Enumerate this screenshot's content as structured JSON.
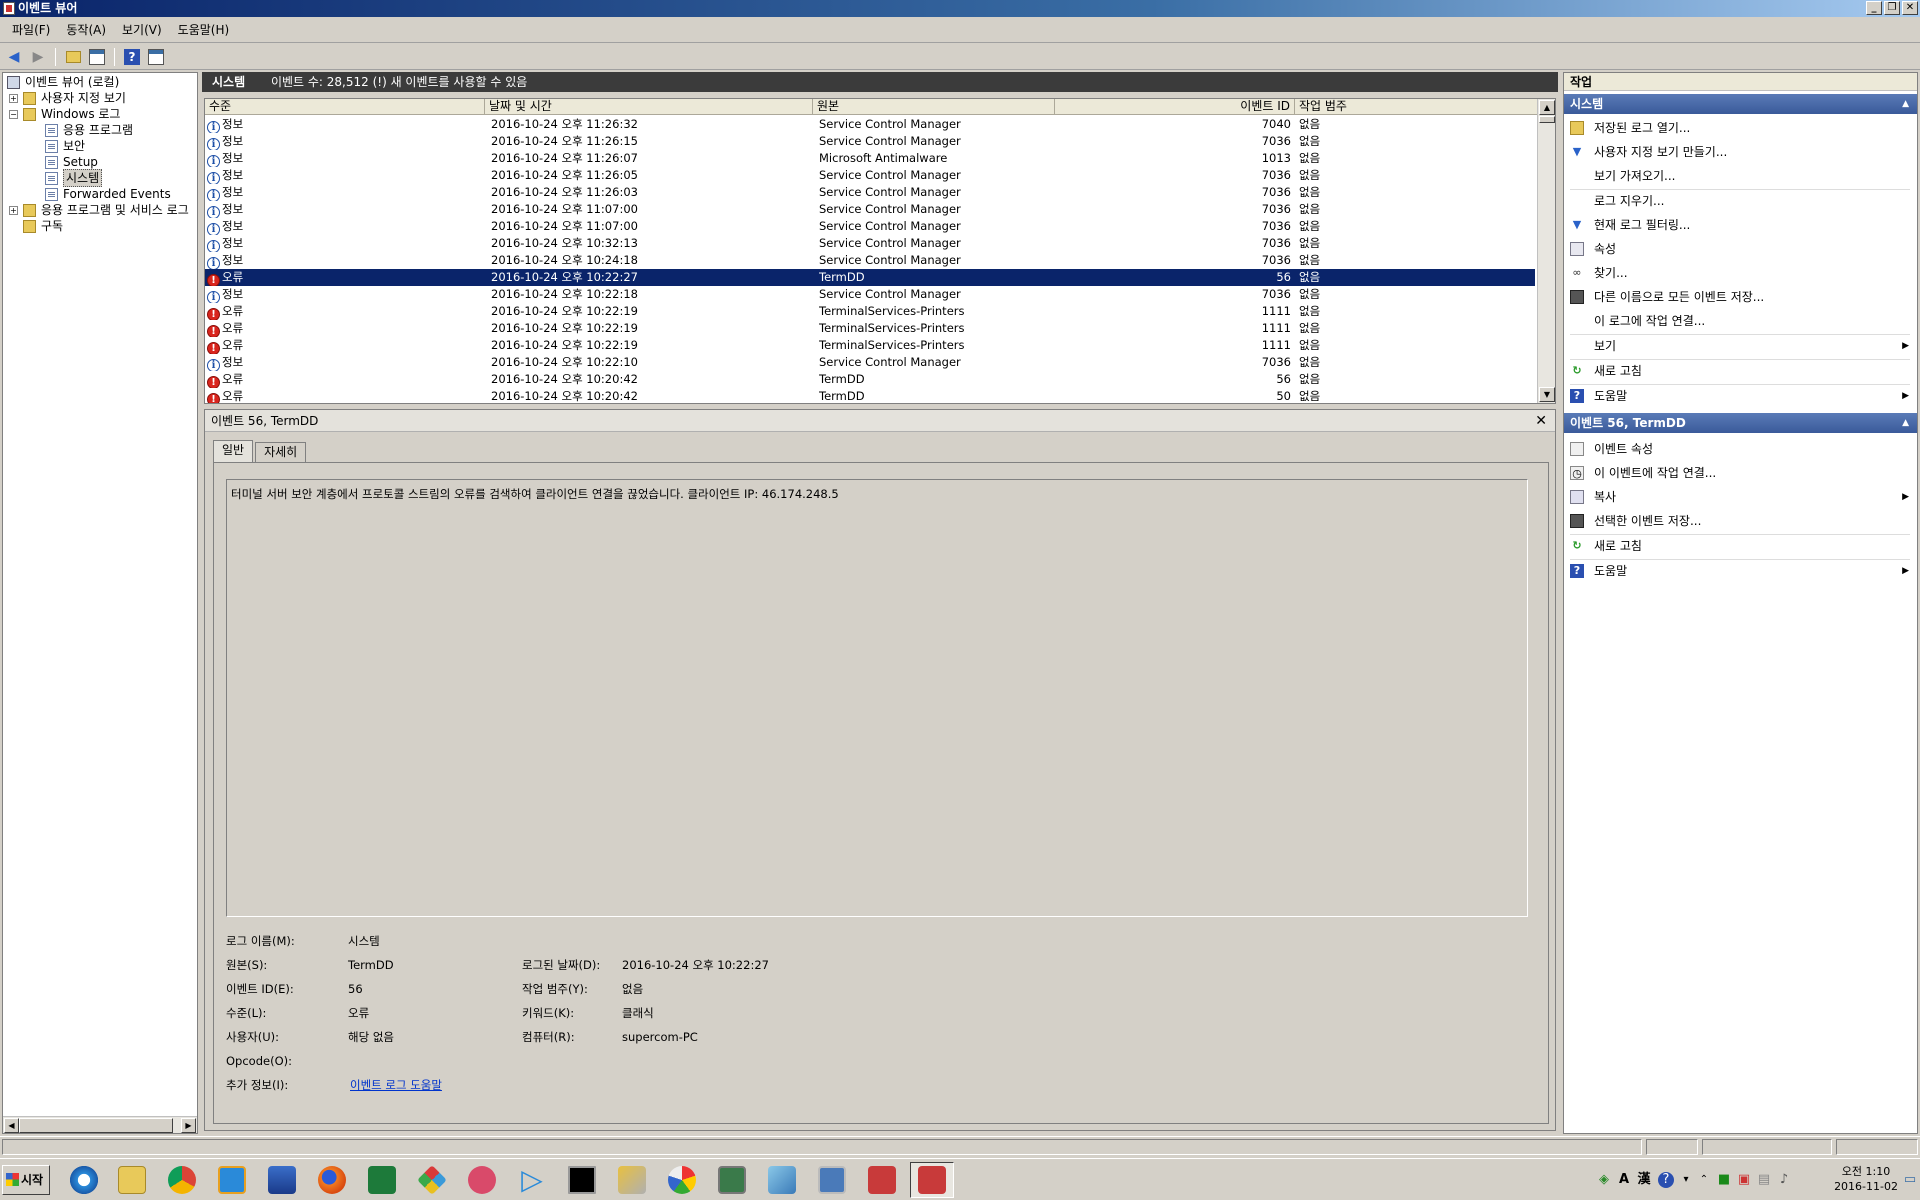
{
  "window": {
    "title": "이벤트 뷰어"
  },
  "menu": [
    "파일(F)",
    "동작(A)",
    "보기(V)",
    "도움말(H)"
  ],
  "tree": {
    "root": "이벤트 뷰어 (로컬)",
    "custom_views": "사용자 지정 보기",
    "windows_logs": "Windows 로그",
    "logs": [
      "응용 프로그램",
      "보안",
      "Setup",
      "시스템",
      "Forwarded Events"
    ],
    "app_services": "응용 프로그램 및 서비스 로그",
    "subscriptions": "구독"
  },
  "center_header": {
    "title": "시스템",
    "info": "이벤트 수: 28,512 (!) 새 이벤트를 사용할 수 있음"
  },
  "columns": [
    "수준",
    "날짜 및 시간",
    "원본",
    "이벤트 ID",
    "작업 범주"
  ],
  "events": [
    {
      "level": "정보",
      "type": "info",
      "datetime": "2016-10-24 오후 11:26:32",
      "source": "Service Control Manager",
      "id": "7040",
      "category": "없음"
    },
    {
      "level": "정보",
      "type": "info",
      "datetime": "2016-10-24 오후 11:26:15",
      "source": "Service Control Manager",
      "id": "7036",
      "category": "없음"
    },
    {
      "level": "정보",
      "type": "info",
      "datetime": "2016-10-24 오후 11:26:07",
      "source": "Microsoft Antimalware",
      "id": "1013",
      "category": "없음"
    },
    {
      "level": "정보",
      "type": "info",
      "datetime": "2016-10-24 오후 11:26:05",
      "source": "Service Control Manager",
      "id": "7036",
      "category": "없음"
    },
    {
      "level": "정보",
      "type": "info",
      "datetime": "2016-10-24 오후 11:26:03",
      "source": "Service Control Manager",
      "id": "7036",
      "category": "없음"
    },
    {
      "level": "정보",
      "type": "info",
      "datetime": "2016-10-24 오후 11:07:00",
      "source": "Service Control Manager",
      "id": "7036",
      "category": "없음"
    },
    {
      "level": "정보",
      "type": "info",
      "datetime": "2016-10-24 오후 11:07:00",
      "source": "Service Control Manager",
      "id": "7036",
      "category": "없음"
    },
    {
      "level": "정보",
      "type": "info",
      "datetime": "2016-10-24 오후 10:32:13",
      "source": "Service Control Manager",
      "id": "7036",
      "category": "없음"
    },
    {
      "level": "정보",
      "type": "info",
      "datetime": "2016-10-24 오후 10:24:18",
      "source": "Service Control Manager",
      "id": "7036",
      "category": "없음"
    },
    {
      "level": "오류",
      "type": "err",
      "datetime": "2016-10-24 오후 10:22:27",
      "source": "TermDD",
      "id": "56",
      "category": "없음",
      "selected": true
    },
    {
      "level": "정보",
      "type": "info",
      "datetime": "2016-10-24 오후 10:22:18",
      "source": "Service Control Manager",
      "id": "7036",
      "category": "없음"
    },
    {
      "level": "오류",
      "type": "err",
      "datetime": "2016-10-24 오후 10:22:19",
      "source": "TerminalServices-Printers",
      "id": "1111",
      "category": "없음"
    },
    {
      "level": "오류",
      "type": "err",
      "datetime": "2016-10-24 오후 10:22:19",
      "source": "TerminalServices-Printers",
      "id": "1111",
      "category": "없음"
    },
    {
      "level": "오류",
      "type": "err",
      "datetime": "2016-10-24 오후 10:22:19",
      "source": "TerminalServices-Printers",
      "id": "1111",
      "category": "없음"
    },
    {
      "level": "정보",
      "type": "info",
      "datetime": "2016-10-24 오후 10:22:10",
      "source": "Service Control Manager",
      "id": "7036",
      "category": "없음"
    },
    {
      "level": "오류",
      "type": "err",
      "datetime": "2016-10-24 오후 10:20:42",
      "source": "TermDD",
      "id": "56",
      "category": "없음"
    },
    {
      "level": "오류",
      "type": "err",
      "datetime": "2016-10-24 오후 10:20:42",
      "source": "TermDD",
      "id": "50",
      "category": "없음"
    }
  ],
  "detail": {
    "header": "이벤트 56, TermDD",
    "tabs": [
      "일반",
      "자세히"
    ],
    "message": "터미널 서버 보안 계층에서 프로토콜 스트림의 오류를 검색하여 클라이언트 연결을 끊었습니다. 클라이언트 IP: 46.174.248.5",
    "labels": {
      "log_name": "로그 이름(M):",
      "source": "원본(S):",
      "event_id": "이벤트 ID(E):",
      "level": "수준(L):",
      "user": "사용자(U):",
      "opcode": "Opcode(O):",
      "more_info": "추가 정보(I):",
      "logged": "로그된 날짜(D):",
      "task": "작업 범주(Y):",
      "keywords": "키워드(K):",
      "computer": "컴퓨터(R):"
    },
    "values": {
      "log_name": "시스템",
      "source": "TermDD",
      "event_id": "56",
      "level": "오류",
      "user": "해당 없음",
      "opcode": "",
      "more_info": "이벤트 로그 도움말",
      "logged": "2016-10-24 오후 10:22:27",
      "task": "없음",
      "keywords": "클래식",
      "computer": "supercom-PC"
    }
  },
  "actions": {
    "title": "작업",
    "section1": "시스템",
    "items1": [
      {
        "label": "저장된 로그 열기...",
        "icon": "folder-open-icon"
      },
      {
        "label": "사용자 지정 보기 만들기...",
        "icon": "filter-icon"
      },
      {
        "label": "보기 가져오기...",
        "icon": ""
      },
      {
        "label": "로그 지우기...",
        "icon": ""
      },
      {
        "label": "현재 로그 필터링...",
        "icon": "filter-icon"
      },
      {
        "label": "속성",
        "icon": "properties-icon"
      },
      {
        "label": "찾기...",
        "icon": "binoculars-icon"
      },
      {
        "label": "다른 이름으로 모든 이벤트 저장...",
        "icon": "save-icon"
      },
      {
        "label": "이 로그에 작업 연결...",
        "icon": ""
      },
      {
        "label": "보기",
        "icon": "",
        "submenu": true
      },
      {
        "label": "새로 고침",
        "icon": "refresh-icon"
      },
      {
        "label": "도움말",
        "icon": "help-icon",
        "submenu": true
      }
    ],
    "section2": "이벤트 56, TermDD",
    "items2": [
      {
        "label": "이벤트 속성",
        "icon": "event-properties-icon"
      },
      {
        "label": "이 이벤트에 작업 연결...",
        "icon": "task-icon"
      },
      {
        "label": "복사",
        "icon": "copy-icon",
        "submenu": true
      },
      {
        "label": "선택한 이벤트 저장...",
        "icon": "save-icon"
      },
      {
        "label": "새로 고침",
        "icon": "refresh-icon"
      },
      {
        "label": "도움말",
        "icon": "help-icon",
        "submenu": true
      }
    ]
  },
  "taskbar": {
    "start": "시작",
    "clock_time": "오전 1:10",
    "clock_date": "2016-11-02",
    "ime_a": "A",
    "ime_han": "漢"
  }
}
